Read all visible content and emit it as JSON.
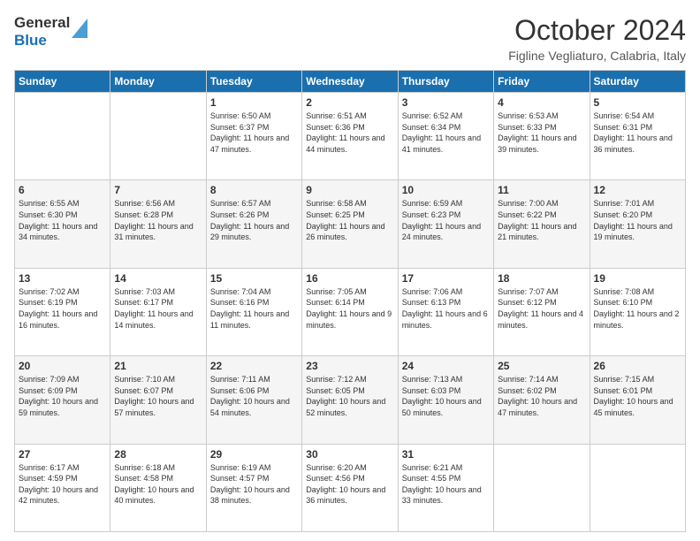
{
  "header": {
    "logo_line1": "General",
    "logo_line2": "Blue",
    "month_title": "October 2024",
    "location": "Figline Vegliaturo, Calabria, Italy"
  },
  "days_of_week": [
    "Sunday",
    "Monday",
    "Tuesday",
    "Wednesday",
    "Thursday",
    "Friday",
    "Saturday"
  ],
  "weeks": [
    [
      {
        "day": "",
        "info": ""
      },
      {
        "day": "",
        "info": ""
      },
      {
        "day": "1",
        "info": "Sunrise: 6:50 AM\nSunset: 6:37 PM\nDaylight: 11 hours and 47 minutes."
      },
      {
        "day": "2",
        "info": "Sunrise: 6:51 AM\nSunset: 6:36 PM\nDaylight: 11 hours and 44 minutes."
      },
      {
        "day": "3",
        "info": "Sunrise: 6:52 AM\nSunset: 6:34 PM\nDaylight: 11 hours and 41 minutes."
      },
      {
        "day": "4",
        "info": "Sunrise: 6:53 AM\nSunset: 6:33 PM\nDaylight: 11 hours and 39 minutes."
      },
      {
        "day": "5",
        "info": "Sunrise: 6:54 AM\nSunset: 6:31 PM\nDaylight: 11 hours and 36 minutes."
      }
    ],
    [
      {
        "day": "6",
        "info": "Sunrise: 6:55 AM\nSunset: 6:30 PM\nDaylight: 11 hours and 34 minutes."
      },
      {
        "day": "7",
        "info": "Sunrise: 6:56 AM\nSunset: 6:28 PM\nDaylight: 11 hours and 31 minutes."
      },
      {
        "day": "8",
        "info": "Sunrise: 6:57 AM\nSunset: 6:26 PM\nDaylight: 11 hours and 29 minutes."
      },
      {
        "day": "9",
        "info": "Sunrise: 6:58 AM\nSunset: 6:25 PM\nDaylight: 11 hours and 26 minutes."
      },
      {
        "day": "10",
        "info": "Sunrise: 6:59 AM\nSunset: 6:23 PM\nDaylight: 11 hours and 24 minutes."
      },
      {
        "day": "11",
        "info": "Sunrise: 7:00 AM\nSunset: 6:22 PM\nDaylight: 11 hours and 21 minutes."
      },
      {
        "day": "12",
        "info": "Sunrise: 7:01 AM\nSunset: 6:20 PM\nDaylight: 11 hours and 19 minutes."
      }
    ],
    [
      {
        "day": "13",
        "info": "Sunrise: 7:02 AM\nSunset: 6:19 PM\nDaylight: 11 hours and 16 minutes."
      },
      {
        "day": "14",
        "info": "Sunrise: 7:03 AM\nSunset: 6:17 PM\nDaylight: 11 hours and 14 minutes."
      },
      {
        "day": "15",
        "info": "Sunrise: 7:04 AM\nSunset: 6:16 PM\nDaylight: 11 hours and 11 minutes."
      },
      {
        "day": "16",
        "info": "Sunrise: 7:05 AM\nSunset: 6:14 PM\nDaylight: 11 hours and 9 minutes."
      },
      {
        "day": "17",
        "info": "Sunrise: 7:06 AM\nSunset: 6:13 PM\nDaylight: 11 hours and 6 minutes."
      },
      {
        "day": "18",
        "info": "Sunrise: 7:07 AM\nSunset: 6:12 PM\nDaylight: 11 hours and 4 minutes."
      },
      {
        "day": "19",
        "info": "Sunrise: 7:08 AM\nSunset: 6:10 PM\nDaylight: 11 hours and 2 minutes."
      }
    ],
    [
      {
        "day": "20",
        "info": "Sunrise: 7:09 AM\nSunset: 6:09 PM\nDaylight: 10 hours and 59 minutes."
      },
      {
        "day": "21",
        "info": "Sunrise: 7:10 AM\nSunset: 6:07 PM\nDaylight: 10 hours and 57 minutes."
      },
      {
        "day": "22",
        "info": "Sunrise: 7:11 AM\nSunset: 6:06 PM\nDaylight: 10 hours and 54 minutes."
      },
      {
        "day": "23",
        "info": "Sunrise: 7:12 AM\nSunset: 6:05 PM\nDaylight: 10 hours and 52 minutes."
      },
      {
        "day": "24",
        "info": "Sunrise: 7:13 AM\nSunset: 6:03 PM\nDaylight: 10 hours and 50 minutes."
      },
      {
        "day": "25",
        "info": "Sunrise: 7:14 AM\nSunset: 6:02 PM\nDaylight: 10 hours and 47 minutes."
      },
      {
        "day": "26",
        "info": "Sunrise: 7:15 AM\nSunset: 6:01 PM\nDaylight: 10 hours and 45 minutes."
      }
    ],
    [
      {
        "day": "27",
        "info": "Sunrise: 6:17 AM\nSunset: 4:59 PM\nDaylight: 10 hours and 42 minutes."
      },
      {
        "day": "28",
        "info": "Sunrise: 6:18 AM\nSunset: 4:58 PM\nDaylight: 10 hours and 40 minutes."
      },
      {
        "day": "29",
        "info": "Sunrise: 6:19 AM\nSunset: 4:57 PM\nDaylight: 10 hours and 38 minutes."
      },
      {
        "day": "30",
        "info": "Sunrise: 6:20 AM\nSunset: 4:56 PM\nDaylight: 10 hours and 36 minutes."
      },
      {
        "day": "31",
        "info": "Sunrise: 6:21 AM\nSunset: 4:55 PM\nDaylight: 10 hours and 33 minutes."
      },
      {
        "day": "",
        "info": ""
      },
      {
        "day": "",
        "info": ""
      }
    ]
  ]
}
